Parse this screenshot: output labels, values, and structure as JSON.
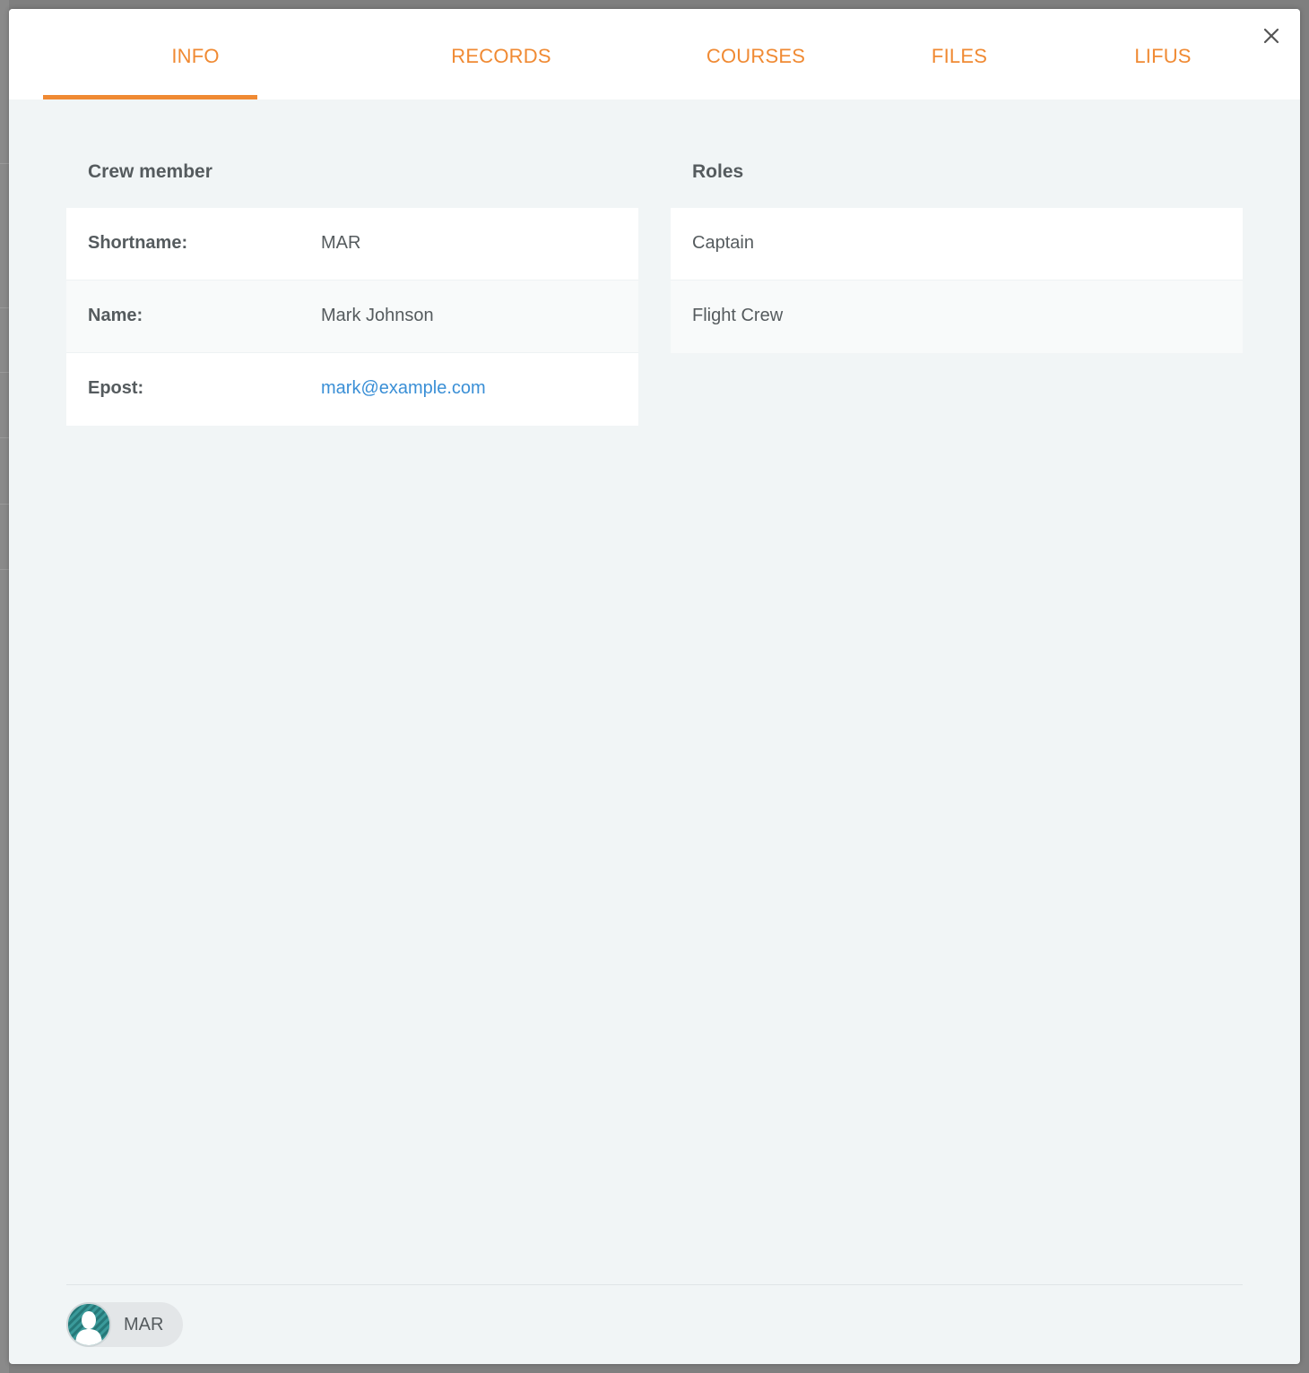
{
  "tabs": [
    {
      "label": "INFO",
      "active": true
    },
    {
      "label": "RECORDS",
      "active": false
    },
    {
      "label": "COURSES",
      "active": false
    },
    {
      "label": "FILES",
      "active": false
    },
    {
      "label": "LIFUS",
      "active": false
    }
  ],
  "accent_color": "#f08a33",
  "link_color": "#3a8fd6",
  "close_icon": "close-icon",
  "crew": {
    "title": "Crew member",
    "rows": [
      {
        "label": "Shortname:",
        "value": "MAR"
      },
      {
        "label": "Name:",
        "value": "Mark Johnson"
      },
      {
        "label": "Epost:",
        "value": "mark@example.com"
      }
    ]
  },
  "roles": {
    "title": "Roles",
    "items": [
      "Captain",
      "Flight Crew"
    ]
  },
  "footer": {
    "user_chip_label": "MAR",
    "avatar_icon": "user-avatar-icon"
  }
}
